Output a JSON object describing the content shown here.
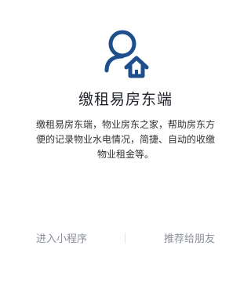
{
  "app": {
    "name": "缴租易房东端",
    "description": "缴租易房东端，物业房东之家，帮助房东方便的记录物业水电情况，简捷、自动的收缴物业租金等。"
  },
  "actions": {
    "enter_label": "进入小程序",
    "recommend_label": "推荐给朋友"
  },
  "icons": {
    "logo": "landlord-user-home-icon"
  },
  "colors": {
    "brand": "#1F4E8C",
    "text_primary": "#1F2329",
    "text_muted": "#8A9099"
  }
}
